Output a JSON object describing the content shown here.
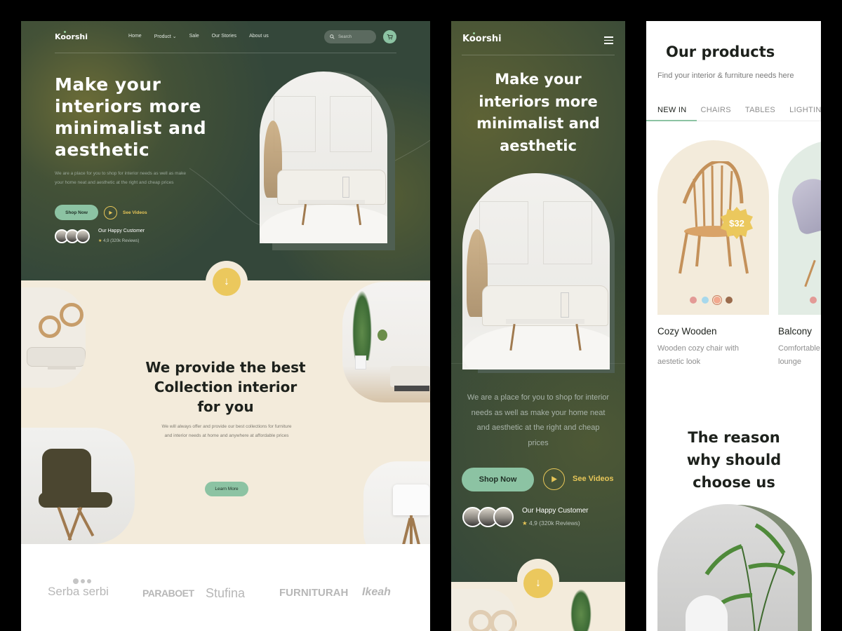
{
  "desktop": {
    "logo": "Koorshi",
    "nav": [
      "Home",
      "Product",
      "Sale",
      "Our Stories",
      "About us"
    ],
    "search_placeholder": "Search",
    "hero": {
      "headline_lines": [
        "Make your",
        "interiors more",
        "minimalist and",
        "aesthetic"
      ],
      "paragraph": "We are a place for you to shop for interior needs as well as make your home neat and aesthetic at the right and cheap prices",
      "shop_button": "Shop Now",
      "videos_link": "See Videos",
      "customer_label": "Our Happy Customer",
      "rating": "4,9 (320k Reviews)"
    },
    "collection": {
      "headline_lines": [
        "We provide the best",
        "Collection interior",
        "for you"
      ],
      "paragraph": "We will always offer and provide our best collections for furniture and interior needs at home and anywhere at affordable prices",
      "button": "Learn More"
    },
    "brands": [
      "Serba serbi",
      "PARABOET",
      "Stufina",
      "FURNITURAH",
      "Ikeah"
    ]
  },
  "mobile": {
    "logo": "Koorshi",
    "headline_lines": [
      "Make your",
      "interiors more",
      "minimalist and",
      "aesthetic"
    ],
    "paragraph": "We are a place for you to shop for interior needs as well as make your home neat and aesthetic at the right and cheap prices",
    "shop_button": "Shop Now",
    "videos_link": "See Videos",
    "customer_label": "Our Happy Customer",
    "rating": "4,9 (320k Reviews)"
  },
  "products": {
    "title": "Our products",
    "subtitle": "Find your interior & furniture needs here",
    "tabs": [
      "NEW IN",
      "CHAIRS",
      "TABLES",
      "LIGHTING"
    ],
    "active_tab": "NEW IN",
    "items": [
      {
        "name": "Cozy Wooden",
        "desc_lines": [
          "Wooden cozy chair with",
          "aestetic look"
        ],
        "price": "$32",
        "swatches": [
          "#e39a96",
          "#a7d8ec",
          "#f2a98f",
          "#9a6b4c"
        ],
        "selected_swatch": 2
      },
      {
        "name": "Balcony",
        "desc_lines": [
          "Comfortable",
          "lounge"
        ],
        "swatches": [
          "#e39a96"
        ]
      }
    ],
    "reason_lines": [
      "The reason",
      "why should",
      "choose us"
    ]
  },
  "colors": {
    "dark_green": "#34473a",
    "sage": "#8cc3a3",
    "gold": "#ebc85d",
    "cream": "#f3ebdb"
  }
}
